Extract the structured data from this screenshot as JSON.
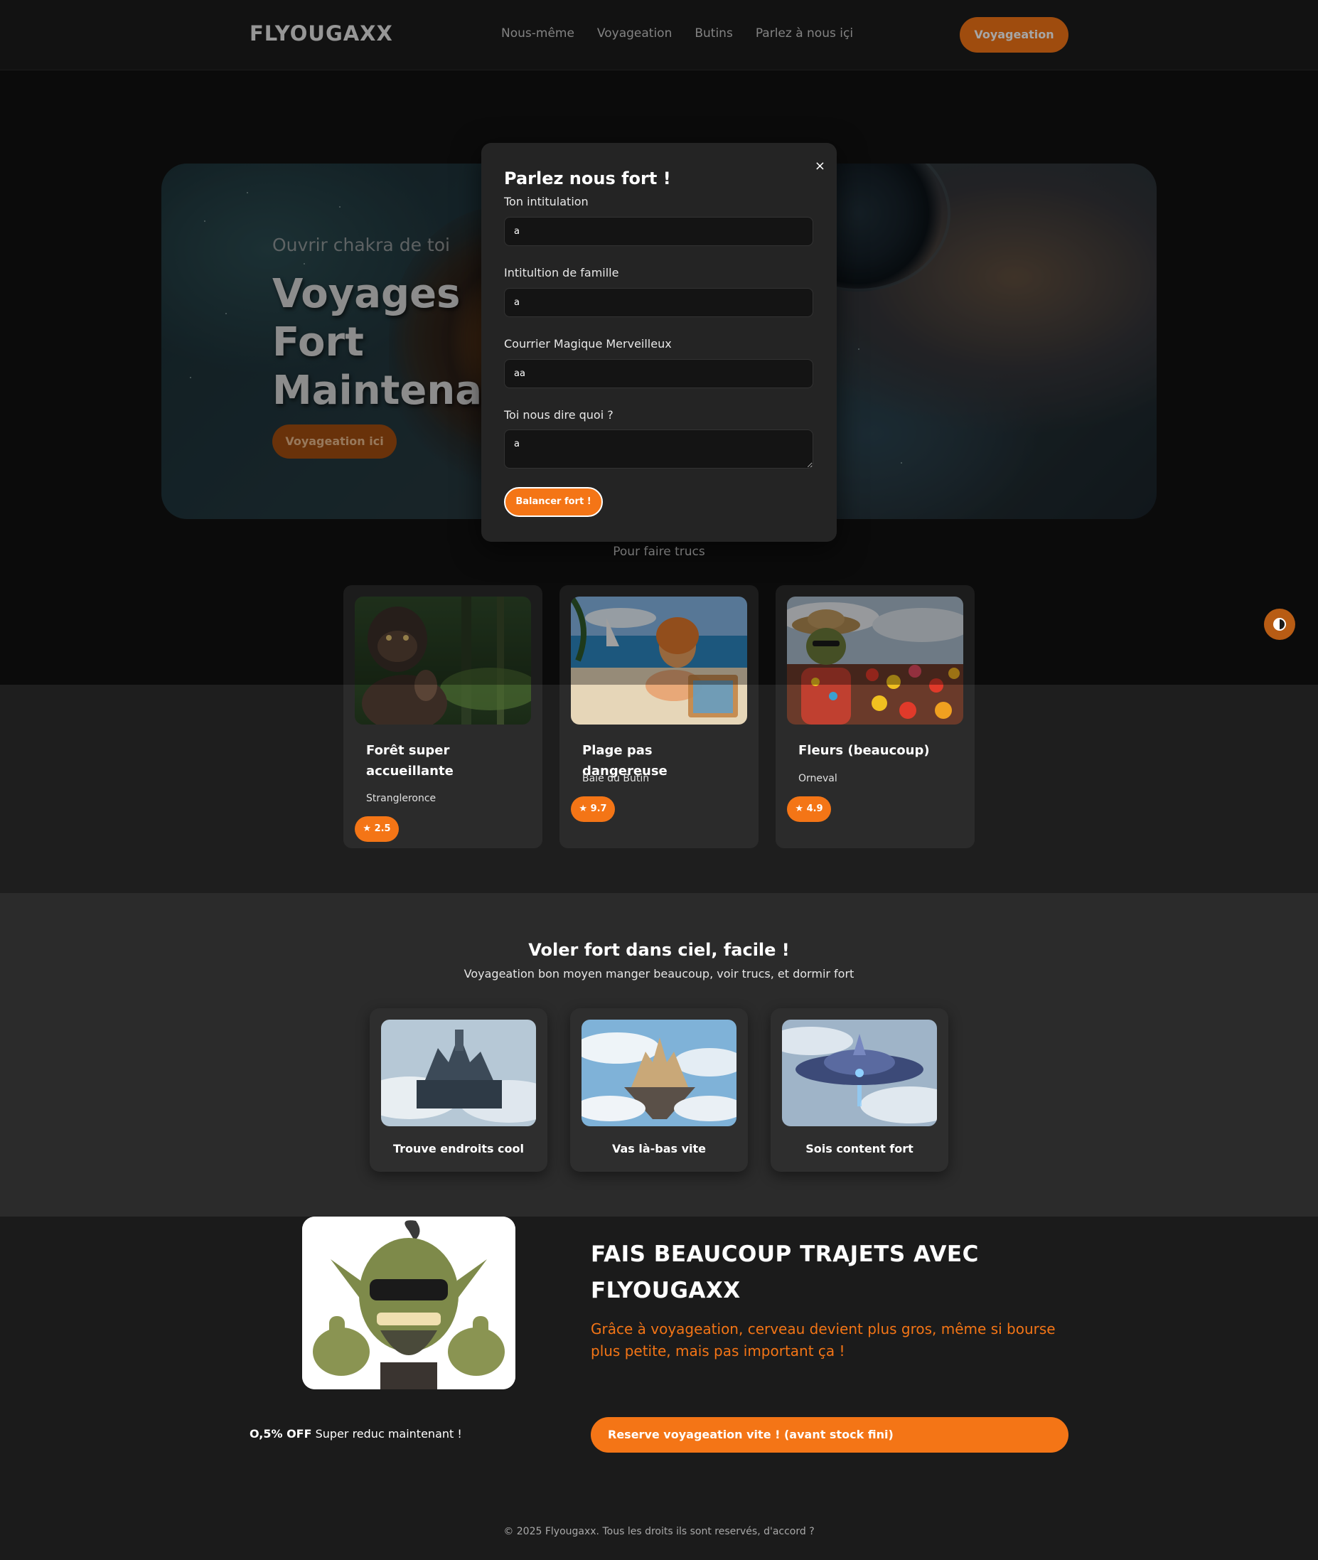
{
  "nav": {
    "brand": "FLYOUGAXX",
    "links": [
      "Nous-même",
      "Voyageation",
      "Butins",
      "Parlez à nous içi"
    ],
    "cta": "Voyageation"
  },
  "hero": {
    "pretitle": "Ouvrir chakra de toi",
    "title": "Voyages\nFort\nMaintenant",
    "button": "Voyageation ici"
  },
  "modal": {
    "title": "Parlez nous fort !",
    "close": "×",
    "fields": [
      {
        "label": "Ton intitulation",
        "value": "a"
      },
      {
        "label": "Intitultion de famille",
        "value": "a"
      },
      {
        "label": "Courrier Magique Merveilleux",
        "value": "aa"
      },
      {
        "label": "Toi nous dire quoi ?",
        "value": "a"
      }
    ],
    "submit": "Balancer fort !"
  },
  "destinations": {
    "caption": "Pour faire trucs",
    "cards": [
      {
        "title": "Forêt super accueillante",
        "location": "Strangleronce",
        "rating": "★ 2.5",
        "image": "troll-in-forest"
      },
      {
        "title": "Plage pas dangereuse",
        "location": "Baie du Butin",
        "rating": "★ 9.7",
        "image": "elf-on-beach"
      },
      {
        "title": "Fleurs (beaucoup)",
        "location": "Orneval",
        "rating": "★ 4.9",
        "image": "goblin-in-flowers"
      }
    ]
  },
  "features": {
    "title": "Voler fort dans ciel, facile !",
    "subtitle": "Voyageation bon moyen manger beaucoup, voir trucs, et dormir fort",
    "cards": [
      {
        "label": "Trouve endroits cool",
        "image": "floating-city"
      },
      {
        "label": "Vas là-bas vite",
        "image": "sky-castle"
      },
      {
        "label": "Sois content fort",
        "image": "airship"
      }
    ]
  },
  "promo": {
    "title": "FAIS BEAUCOUP TRAJETS AVEC FLYOUGAXX",
    "text": "Grâce à voyageation, cerveau devient plus gros, même si bourse plus petite, mais pas important ça !",
    "discount_strong": "O,5% OFF",
    "discount_text": " Super reduc maintenant !",
    "button": "Reserve voyageation vite ! (avant stock fini)",
    "image": "goblin-thumbs-up"
  },
  "footer": {
    "text": "© 2025 Flyougaxx. Tous les droits ils sont reservés, d'accord ?"
  },
  "colors": {
    "accent": "#f47516",
    "background": "#1b1b1b",
    "card": "#2b2b2b"
  },
  "icons": [
    "close-icon",
    "star-icon",
    "theme-toggle-icon"
  ]
}
